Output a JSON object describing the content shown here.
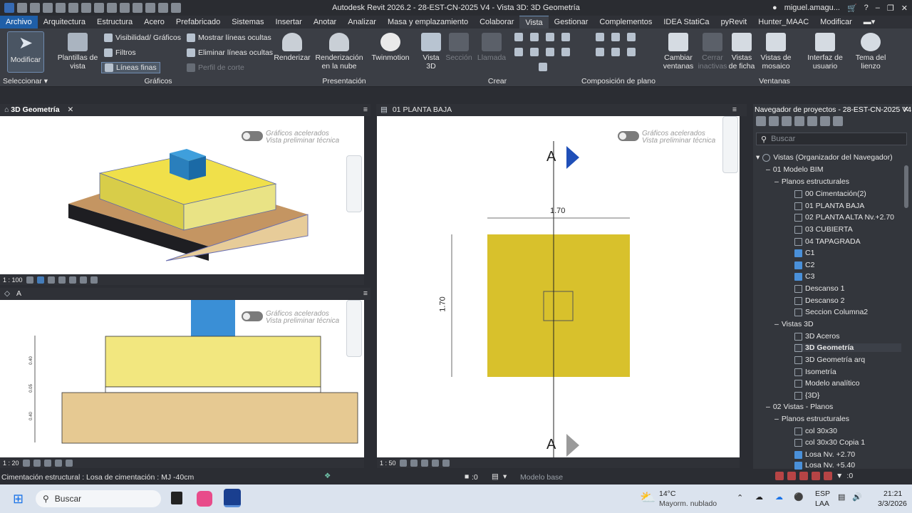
{
  "titlebar": {
    "title": "Autodesk Revit 2026.2 - 28-EST-CN-2025 V4 - Vista 3D: 3D Geometría",
    "user": "miguel.amagu...",
    "help": "?"
  },
  "menu": [
    "Archivo",
    "Arquitectura",
    "Estructura",
    "Acero",
    "Prefabricado",
    "Sistemas",
    "Insertar",
    "Anotar",
    "Analizar",
    "Masa y emplazamiento",
    "Colaborar",
    "Vista",
    "Gestionar",
    "Complementos",
    "IDEA StatiCa",
    "pyRevit",
    "Hunter_MAAC",
    "Modificar"
  ],
  "ribbon": {
    "modificar": "Modificar",
    "plantillas": "Plantillas de vista",
    "visibilidad": "Visibilidad/ Gráficos",
    "filtros": "Filtros",
    "lineas_finas": "Líneas finas",
    "mostrar_lineas": "Mostrar líneas ocultas",
    "eliminar_lineas": "Eliminar líneas ocultas",
    "perfil_corte": "Perfil de corte",
    "renderizar": "Renderizar",
    "render_nube": "Renderización en la nube",
    "twinmotion": "Twinmotion",
    "vista3d": "Vista 3D",
    "seccion": "Sección",
    "llamada": "Llamada",
    "cambiar_ventanas": "Cambiar ventanas",
    "cerrar_inactivas": "Cerrar inactivas",
    "vistas_ficha": "Vistas de ficha",
    "vistas_mosaico": "Vistas de mosaico",
    "interfaz_usuario": "Interfaz de usuario",
    "tema_lienzo": "Tema del lienzo",
    "groups": {
      "seleccionar": "Seleccionar",
      "graficos": "Gráficos",
      "presentacion": "Presentación",
      "crear": "Crear",
      "composicion": "Composición de plano",
      "ventanas": "Ventanas"
    }
  },
  "views": {
    "v3d": {
      "tab": "3D Geometría",
      "scale": "1 : 100"
    },
    "section": {
      "tab": "A",
      "scale": "1 : 20",
      "dim_top": "0.40",
      "dim_mid": "0.05",
      "dim_bot": "0.40"
    },
    "plan": {
      "tab": "01 PLANTA BAJA",
      "scale": "1 : 50",
      "dim_h": "1.70",
      "dim_v": "1.70",
      "marker": "A"
    },
    "toggle_line1": "Gráficos acelerados",
    "toggle_line2": "Vista preliminar técnica"
  },
  "browser": {
    "title": "Navegador de proyectos - 28-EST-CN-2025 V4",
    "search_placeholder": "Buscar",
    "items": [
      "Vistas (Organizador del Navegador)",
      "01 Modelo BIM",
      "Planos estructurales",
      "00 Cimentación(2)",
      "01 PLANTA BAJA",
      "02 PLANTA ALTA Nv.+2.70",
      "03 CUBIERTA",
      "04 TAPAGRADA",
      "C1",
      "C2",
      "C3",
      "Descanso 1",
      "Descanso 2",
      "Seccion Columna2",
      "Vistas 3D",
      "3D Aceros",
      "3D Geometría",
      "3D Geometría arq",
      "Isometría",
      "Modelo analítico",
      "{3D}",
      "02 Vistas - Planos",
      "Planos estructurales",
      "col 30x30",
      "col 30x30 Copia 1",
      "Losa Nv. +2.70",
      "Losa Nv. +5.40"
    ]
  },
  "status": {
    "text": "Cimentación estructural : Losa de cimentación : MJ -40cm",
    "count": ":0",
    "modelo": "Modelo base",
    "filter": ":0"
  },
  "taskbar": {
    "search": "Buscar",
    "temp": "14°C",
    "weather": "Mayorm. nublado",
    "lang1": "ESP",
    "lang2": "LAA",
    "time": "21:21",
    "date": "3/3/2026"
  },
  "colors": {
    "accent": "#1f5fa8",
    "footing_yellow": "#f2e266",
    "slab_tan": "#e6c992",
    "column_blue": "#3a8fd6",
    "plan_yellow": "#d8c12c"
  }
}
